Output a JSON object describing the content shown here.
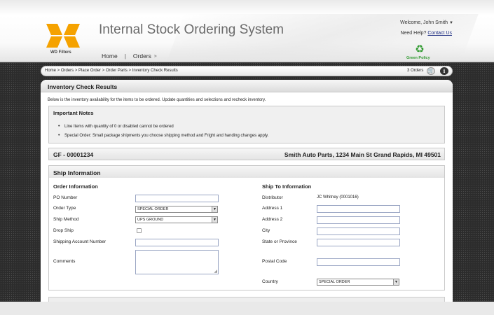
{
  "header": {
    "app_title": "Internal Stock Ordering System",
    "logo_text": "WD Filters",
    "logo_color": "#f5a200",
    "nav": {
      "home": "Home",
      "separator": "|",
      "orders": "Orders",
      "orders_chevron_icon": "double-chevron-down-icon"
    },
    "welcome": "Welcome, John Smith",
    "welcome_caret": "▼",
    "need_help": "Need Help?",
    "contact_us": "Contact Us",
    "green_policy": "Green Policy",
    "green_color": "#2f9a2f"
  },
  "breadcrumb": {
    "path": "Home > Orders > Place Order > Order Parts > Inventory Check Results",
    "cart_count": "3 Orders",
    "cart_icon": "cart-icon",
    "info_icon": "info-icon",
    "info_glyph": "i"
  },
  "main": {
    "panel_title": "Inventory Check Results",
    "intro": "Below is the inventory availability for the items to be ordered. Update quantities and selections and recheck inventory.",
    "notes": {
      "title": "Important Notes",
      "items": [
        "Line Items with quantity of 0 or disabled cannot be ordered",
        "Special Order: Small package shipments you choose shipping method and Fright and handing changes apply."
      ]
    },
    "order_bar": {
      "order_id": "GF - 00001234",
      "customer": "Smith Auto Parts, 1234 Main St Grand Rapids, MI 49501"
    },
    "ship": {
      "title": "Ship Information",
      "order_info": {
        "title": "Order Information",
        "po_number_label": "PO Number",
        "po_number_value": "",
        "order_type_label": "Order Type",
        "order_type_value": "SPECIAL ORDER",
        "ship_method_label": "Ship Method",
        "ship_method_value": "UPS GROUND",
        "drop_ship_label": "Drop Ship",
        "shipping_account_label": "Shipping Account Number",
        "shipping_account_value": "",
        "comments_label": "Comments",
        "comments_value": ""
      },
      "ship_to": {
        "title": "Ship To Information",
        "distributor_label": "Distributor",
        "distributor_value": "JC Whitney (0001016)",
        "address1_label": "Address 1",
        "address2_label": "Address 2",
        "city_label": "City",
        "state_label": "State or Province",
        "postal_label": "Postal Code",
        "country_label": "Country",
        "country_value": "SPECIAL ORDER"
      }
    }
  }
}
